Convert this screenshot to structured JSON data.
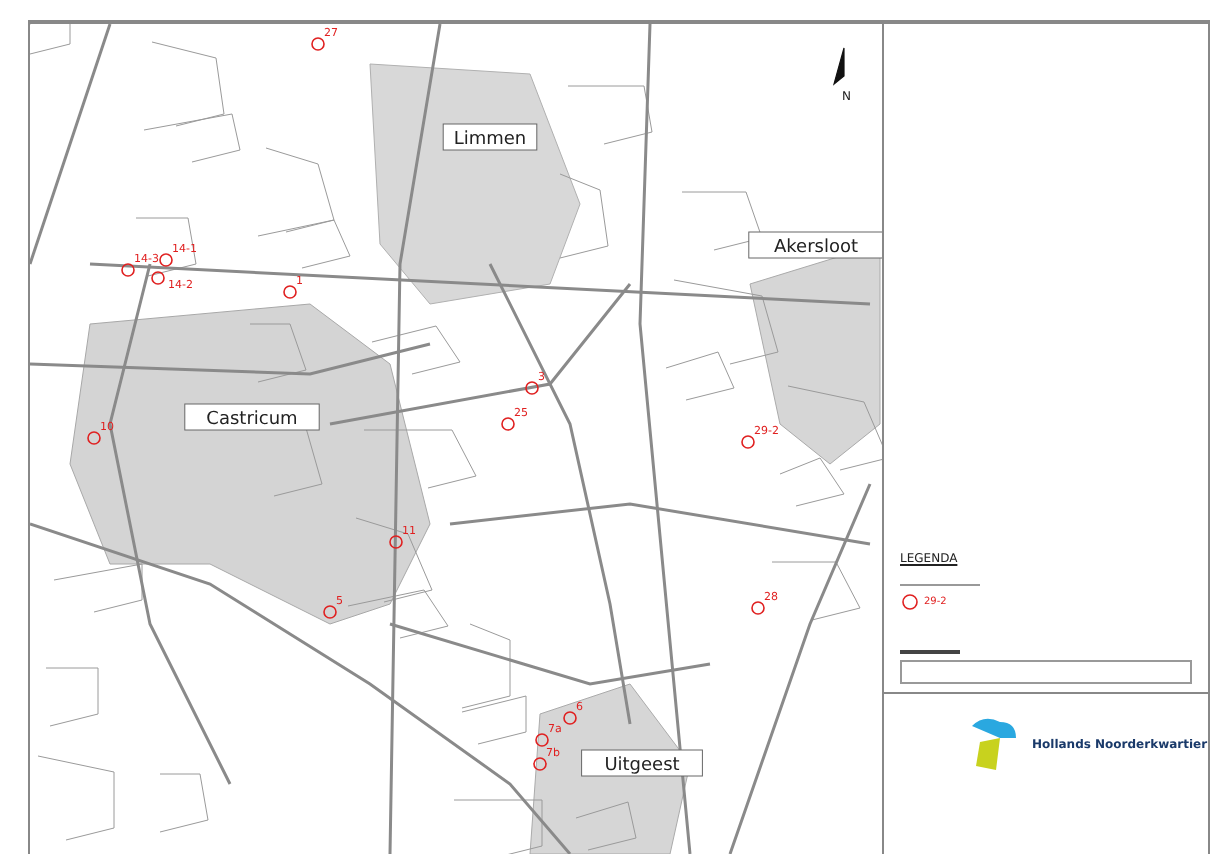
{
  "map": {
    "north_label": "N",
    "places": [
      {
        "name": "Limmen"
      },
      {
        "name": "Castricum"
      },
      {
        "name": "Akersloot"
      },
      {
        "name": "Uitgeest"
      }
    ],
    "markers": [
      {
        "label": "27"
      },
      {
        "label": "14-3"
      },
      {
        "label": "14-1"
      },
      {
        "label": "14-2"
      },
      {
        "label": "1"
      },
      {
        "label": "10"
      },
      {
        "label": "3"
      },
      {
        "label": "25"
      },
      {
        "label": "11"
      },
      {
        "label": "5"
      },
      {
        "label": "29-2"
      },
      {
        "label": "28"
      },
      {
        "label": "6"
      },
      {
        "label": "7a"
      },
      {
        "label": "7b"
      }
    ]
  },
  "legend": {
    "title": "LEGENDA",
    "sample_label": "29-2"
  },
  "title_block": {
    "organization": "Hollands Noorderkwartier"
  }
}
